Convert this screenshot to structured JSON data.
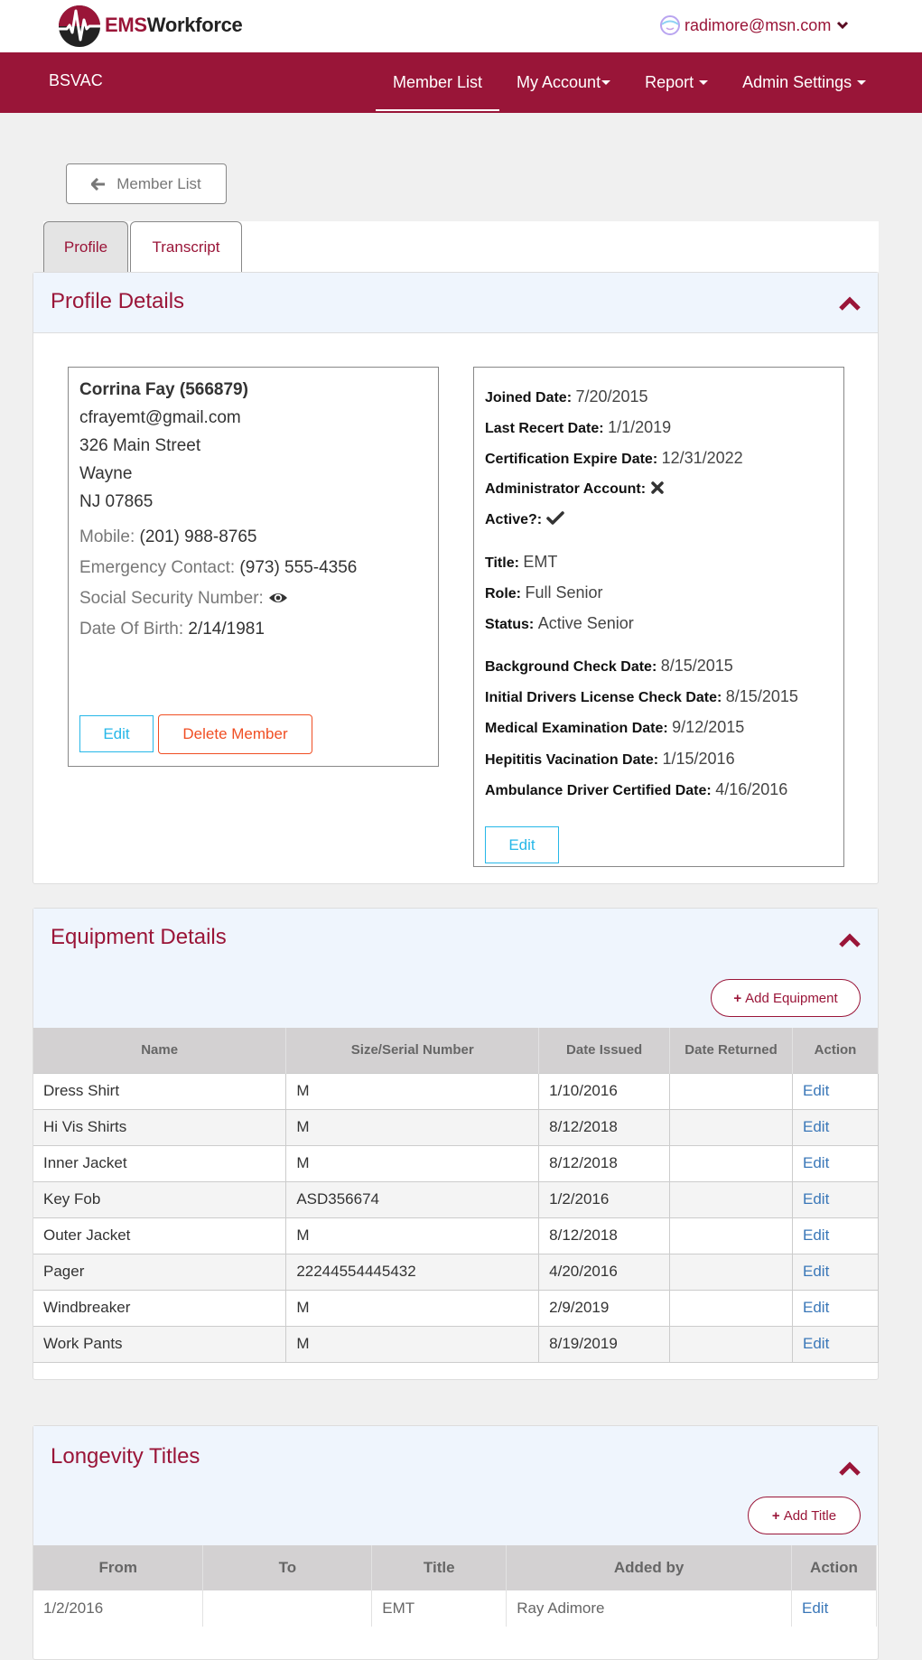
{
  "header": {
    "logo_ems": "EMS",
    "logo_workforce": "Workforce",
    "user_email": "radimore@msn.com"
  },
  "navbar": {
    "brand": "BSVAC",
    "items": [
      {
        "label": "Member List",
        "active": true,
        "dropdown": false
      },
      {
        "label": "My Account",
        "active": false,
        "dropdown": true
      },
      {
        "label": "Report",
        "active": false,
        "dropdown": true
      },
      {
        "label": "Admin Settings",
        "active": false,
        "dropdown": true
      }
    ]
  },
  "back_button": {
    "label": "Member List",
    "icon": "arrow-left-icon"
  },
  "tabs": [
    {
      "label": "Profile",
      "active": true
    },
    {
      "label": "Transcript",
      "active": false
    }
  ],
  "profile": {
    "title": "Profile Details",
    "contact": {
      "name_line": "Corrina Fay (566879)",
      "email": "cfrayemt@gmail.com",
      "street": "326 Main Street",
      "city": "Wayne",
      "state_zip": "NJ 07865",
      "mobile_label": "Mobile:",
      "mobile": "(201) 988-8765",
      "emergency_label": "Emergency Contact:",
      "emergency": "(973) 555-4356",
      "ssn_label": "Social Security Number:",
      "ssn_icon": "eye-icon",
      "dob_label": "Date Of Birth:",
      "dob": "2/14/1981",
      "edit_label": "Edit",
      "delete_label": "Delete Member"
    },
    "details": {
      "joined_label": "Joined Date:",
      "joined": "7/20/2015",
      "recert_label": "Last Recert Date:",
      "recert": "1/1/2019",
      "cert_expire_label": "Certification Expire Date:",
      "cert_expire": "12/31/2022",
      "admin_label": "Administrator Account:",
      "admin": false,
      "active_label": "Active?:",
      "active": true,
      "title_label": "Title:",
      "title": "EMT",
      "role_label": "Role:",
      "role": "Full Senior",
      "status_label": "Status:",
      "status": "Active Senior",
      "background_label": "Background Check Date:",
      "background": "8/15/2015",
      "license_label": "Initial Drivers License Check Date:",
      "license": "8/15/2015",
      "medical_label": "Medical Examination Date:",
      "medical": "9/12/2015",
      "hepatitis_label": "Hepititis Vacination Date:",
      "hepatitis": "1/15/2016",
      "ambulance_label": "Ambulance Driver Certified Date:",
      "ambulance": "4/16/2016",
      "edit_label": "Edit"
    }
  },
  "equipment": {
    "title": "Equipment Details",
    "add_label": "Add Equipment",
    "columns": [
      "Name",
      "Size/Serial Number",
      "Date Issued",
      "Date Returned",
      "Action"
    ],
    "rows": [
      {
        "name": "Dress Shirt",
        "size": "M",
        "issued": "1/10/2016",
        "returned": "",
        "action": "Edit"
      },
      {
        "name": "Hi Vis Shirts",
        "size": "M",
        "issued": "8/12/2018",
        "returned": "",
        "action": "Edit"
      },
      {
        "name": "Inner Jacket",
        "size": "M",
        "issued": "8/12/2018",
        "returned": "",
        "action": "Edit"
      },
      {
        "name": "Key Fob",
        "size": "ASD356674",
        "issued": "1/2/2016",
        "returned": "",
        "action": "Edit"
      },
      {
        "name": "Outer Jacket",
        "size": "M",
        "issued": "8/12/2018",
        "returned": "",
        "action": "Edit"
      },
      {
        "name": "Pager",
        "size": "22244554445432",
        "issued": "4/20/2016",
        "returned": "",
        "action": "Edit"
      },
      {
        "name": "Windbreaker",
        "size": "M",
        "issued": "2/9/2019",
        "returned": "",
        "action": "Edit"
      },
      {
        "name": "Work Pants",
        "size": "M",
        "issued": "8/19/2019",
        "returned": "",
        "action": "Edit"
      }
    ]
  },
  "longevity": {
    "title": "Longevity Titles",
    "add_label": "Add Title",
    "columns": [
      "From",
      "To",
      "Title",
      "Added by",
      "Action"
    ],
    "rows": [
      {
        "from": "1/2/2016",
        "to": "",
        "title": "EMT",
        "added_by": "Ray Adimore",
        "action": "Edit"
      }
    ]
  },
  "colors": {
    "brand": "#991538",
    "panel_header": "#eff5fd",
    "edit_button": "#26b7e8",
    "delete_button": "#f04e23",
    "link": "#3a77b8"
  }
}
